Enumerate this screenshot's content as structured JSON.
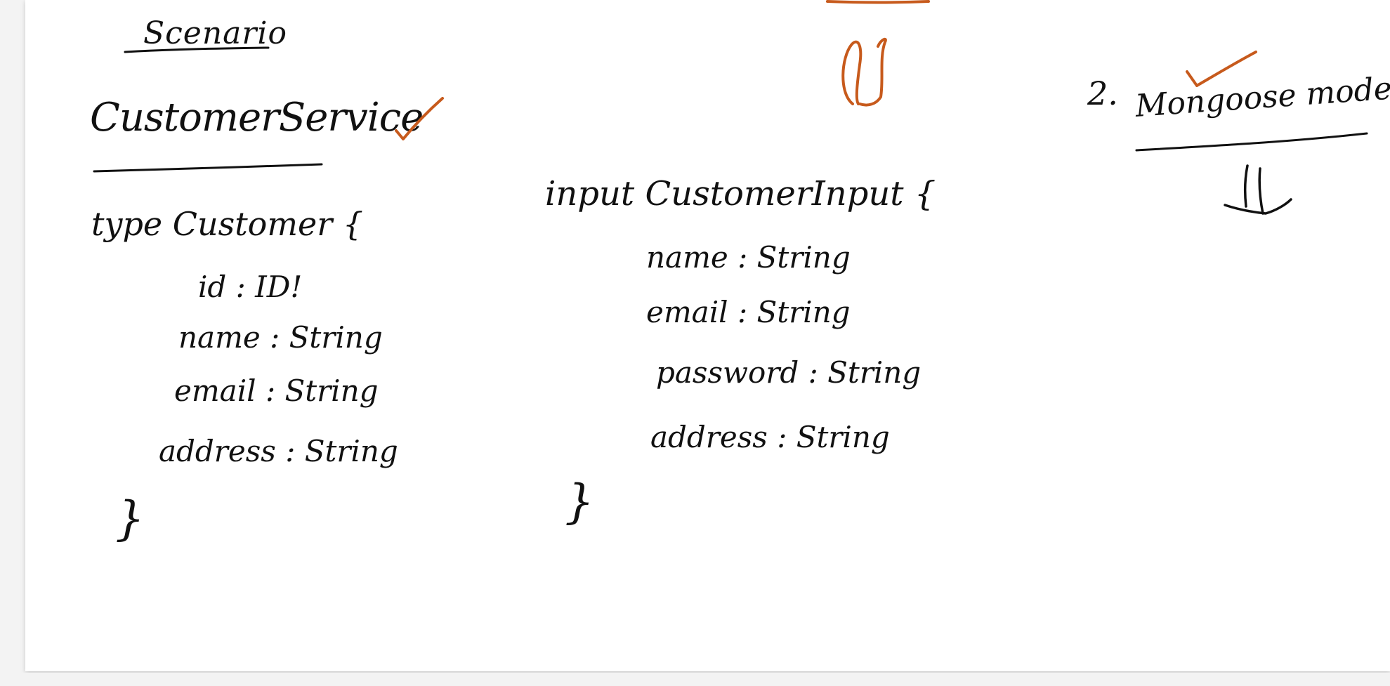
{
  "colors": {
    "ink": "#111111",
    "accent_ink": "#c75a1c",
    "canvas": "#ffffff",
    "background": "#f3f3f3"
  },
  "notes": {
    "title": "Scenario",
    "service_heading": "CustomerService",
    "customer_type": {
      "header": "type Customer {",
      "fields": [
        "id : ID!",
        "name : String",
        "email : String",
        "address : String"
      ],
      "close": "}"
    },
    "customer_input": {
      "header": "input CustomerInput {",
      "fields": [
        "name : String",
        "email : String",
        "password : String",
        "address : String"
      ],
      "close": "}"
    },
    "mongoose": {
      "prefix": "2.",
      "label": "Mongoose model"
    }
  }
}
